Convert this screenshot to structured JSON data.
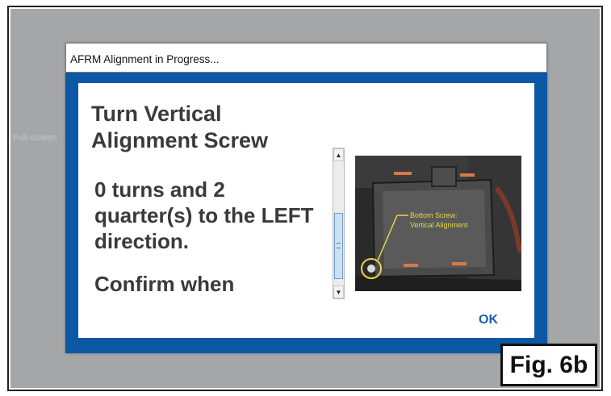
{
  "dialog": {
    "title": "AFRM Alignment in Progress...",
    "heading": "Turn Vertical Alignment Screw",
    "instruction": "0 turns and 2 quarter(s) to the LEFT direction.",
    "confirm_text": "Confirm when",
    "ok_label": "OK"
  },
  "background": {
    "ghost_text": "Full-screen"
  },
  "image": {
    "annotation_line1": "Bottom Screw:",
    "annotation_line2": "Vertical Alignment",
    "annotation_color": "#e6d64a"
  },
  "figure": {
    "label": "Fig. 6b"
  },
  "colors": {
    "dialog_border": "#0c58a4",
    "backdrop": "#a5a6a8",
    "ok_text": "#1a5fae"
  }
}
